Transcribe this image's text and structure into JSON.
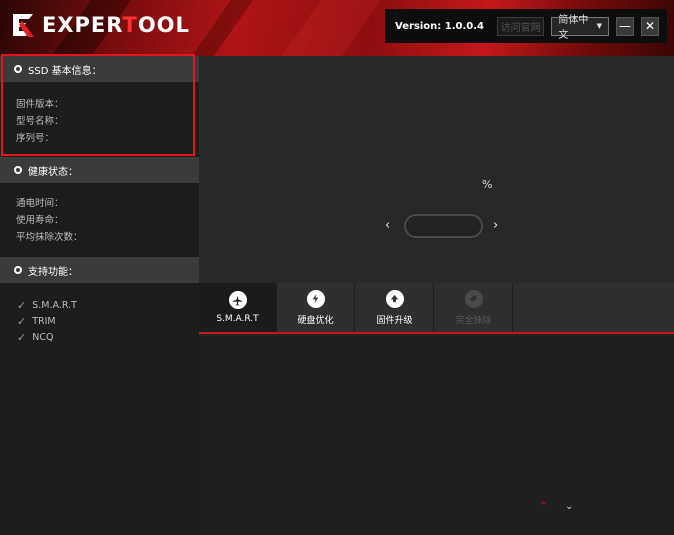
{
  "app": {
    "logo_text_a": "EXPER",
    "logo_text_b": "T",
    "logo_text_c": "OOL"
  },
  "toolbar": {
    "version": "Version: 1.0.0.4",
    "visit_site_label": "访问官网",
    "language_selected": "简体中文",
    "minimize_glyph": "—",
    "close_glyph": "✕"
  },
  "sidebar": {
    "ssd_info": {
      "title": "SSD 基本信息：",
      "firmware_label": "固件版本：",
      "model_label": "型号名称：",
      "serial_label": "序列号："
    },
    "health": {
      "title": "健康状态：",
      "power_on_label": "通电时间：",
      "life_label": "使用寿命：",
      "erase_label": "平均抹除次数："
    },
    "features": {
      "title": "支持功能：",
      "items": [
        "S.M.A.R.T",
        "TRIM",
        "NCQ"
      ]
    }
  },
  "main": {
    "percent_symbol": "%",
    "prev_arrow": "‹",
    "next_arrow": "›",
    "tabs": [
      {
        "label": "S.M.A.R.T",
        "icon": "airplane-icon",
        "state": "active"
      },
      {
        "label": "硬盘优化",
        "icon": "lightning-icon",
        "state": "normal"
      },
      {
        "label": "固件升级",
        "icon": "upload-icon",
        "state": "normal"
      },
      {
        "label": "完全抹除",
        "icon": "eraser-icon",
        "state": "disabled"
      }
    ],
    "scroll_up": "⌃",
    "scroll_down": "⌄"
  },
  "colors": {
    "accent": "#c41818",
    "highlight_border": "#e0161b"
  }
}
